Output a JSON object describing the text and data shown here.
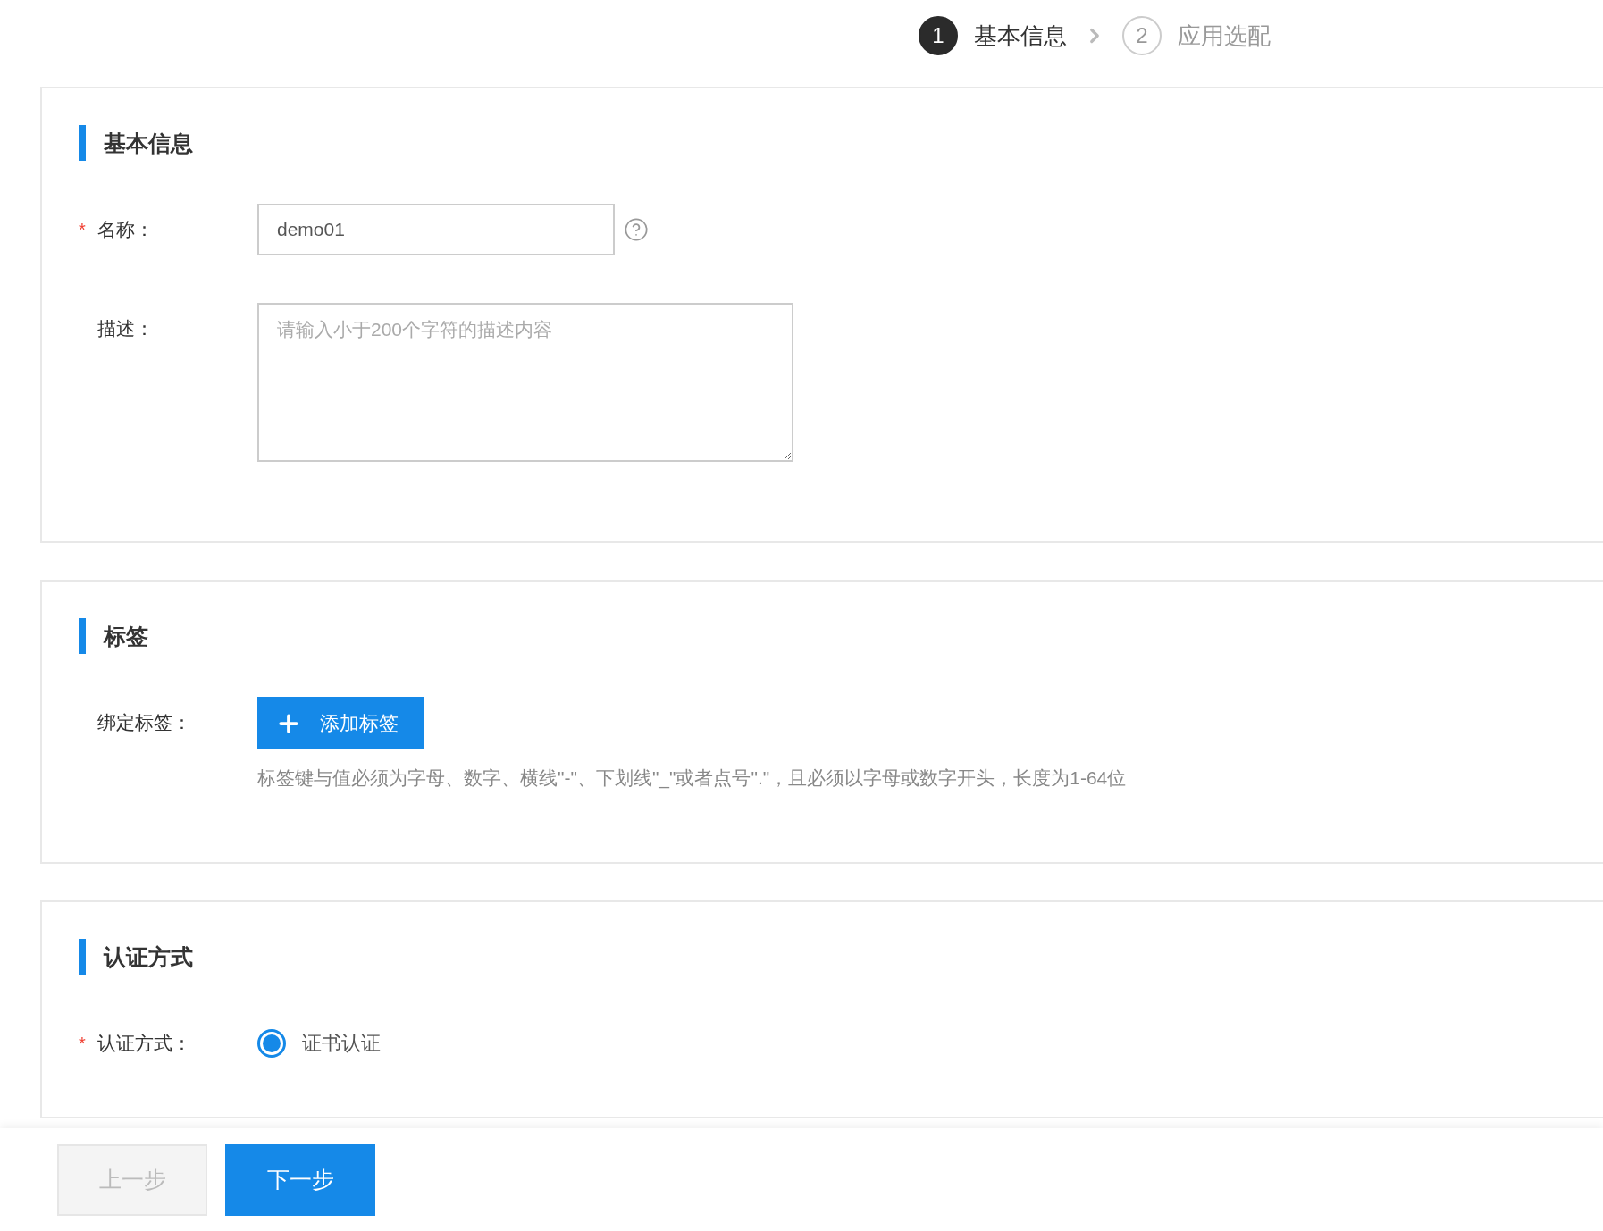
{
  "steps": [
    {
      "number": "1",
      "label": "基本信息",
      "selected": true
    },
    {
      "number": "2",
      "label": "应用选配",
      "selected": false
    }
  ],
  "sections": [
    {
      "title": "基本信息",
      "fields": [
        {
          "kind": "text_input",
          "required_mark": "*",
          "label": "名称：",
          "value": "demo01"
        },
        {
          "kind": "textarea",
          "label": "描述：",
          "placeholder": "请输入小于200个字符的描述内容"
        }
      ]
    },
    {
      "title": "标签",
      "fields": [
        {
          "kind": "tag_button",
          "label": "绑定标签：",
          "button": "添加标签",
          "hint": "标签键与值必须为字母、数字、横线\"-\"、下划线\"_\"或者点号\".\"，且必须以字母或数字开头，长度为1-64位"
        }
      ]
    },
    {
      "title": "认证方式",
      "fields": [
        {
          "kind": "radio",
          "required_mark": "*",
          "label": "认证方式：",
          "options": [
            {
              "label": "证书认证",
              "selected": true
            }
          ]
        }
      ]
    }
  ],
  "footer": {
    "buttons": [
      {
        "label": "上一步",
        "disabled": true
      },
      {
        "label": "下一步",
        "disabled": false
      }
    ]
  }
}
